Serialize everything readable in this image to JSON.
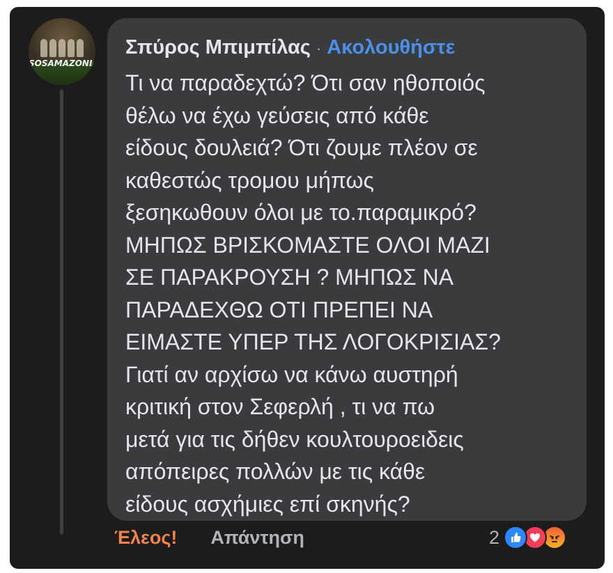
{
  "comment": {
    "avatar_logo_text": "SOSAMAZONIA",
    "author_name": "Σπύρος Μπιμπίλας",
    "separator": "·",
    "follow_label": "Ακολουθήστε",
    "body_lines": [
      "Τι να παραδεχτώ? Ότι σαν ηθοποιός",
      "θέλω να έχω γεύσεις από κάθε",
      "είδους δουλειά? Ότι ζουμε πλέον σε",
      "καθεστώς τρομου μήπως",
      "ξεσηκωθουν όλοι με το.παραμικρό?",
      "ΜΗΠΩΣ ΒΡΙΣΚΟΜΑΣΤΕ ΟΛΟΙ ΜΑΖΙ",
      "ΣΕ ΠΑΡΑΚΡΟΥΣΗ ? ΜΗΠΩΣ ΝΑ",
      "ΠΑΡΑΔΕΧΘΩ ΟΤΙ ΠΡΕΠΕΙ ΝΑ",
      "ΕΙΜΑΣΤΕ ΥΠΕΡ ΤΗΣ ΛΟΓΟΚΡΙΣΙΑΣ?",
      "Γιατί αν αρχίσω να κάνω αυστηρή",
      "κριτική στον Σεφερλή , τι να πω",
      "μετά για τις δήθεν κουλτουροειδεις",
      "απόπειρες πολλών με τις κάθε",
      "είδους ασχήμιες επί σκηνής?"
    ]
  },
  "actions": {
    "reaction_label": "Έλεος!",
    "reply_label": "Απάντηση"
  },
  "reactions": {
    "count": "2",
    "icons": [
      "like-icon",
      "love-icon",
      "angry-icon"
    ]
  },
  "colors": {
    "background": "#1c1c1d",
    "bubble": "#3a3b3c",
    "text": "#e4e6eb",
    "follow": "#4a8fe8",
    "reaction_label": "#f0844a",
    "muted": "#b0b3b8"
  }
}
